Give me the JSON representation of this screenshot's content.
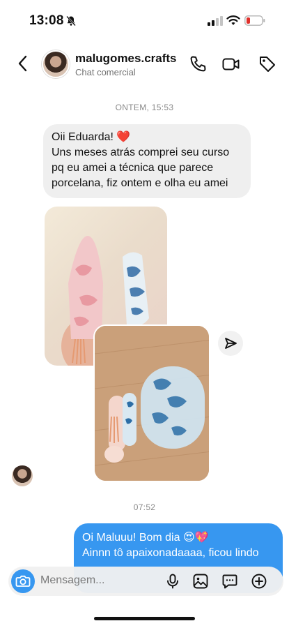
{
  "status_bar": {
    "time": "13:08",
    "icons": [
      "bell-slash-icon",
      "signal-icon",
      "wifi-icon",
      "battery-low-icon"
    ],
    "battery_color": "#e0302b"
  },
  "header": {
    "username": "malugomes.crafts",
    "subtitle": "Chat comercial",
    "icons": [
      "chevron-left-icon",
      "phone-icon",
      "video-camera-icon",
      "tag-icon"
    ]
  },
  "conversation": {
    "date_stamp_1": "ONTEM, 15:53",
    "incoming_message": {
      "line1": "Oii Eduarda! ❤️",
      "line2": "Uns meses atrás comprei seu curso",
      "line3": "pq eu amei a técnica que parece",
      "line4": "porcelana, fiz ontem e olha eu amei"
    },
    "photos": [
      "bookmark-photo-icon",
      "resin-pieces-photo-icon"
    ],
    "date_stamp_2": "07:52",
    "outgoing_message": {
      "line1": "Oi Maluuu! Bom dia 😍💖",
      "line2": "Ainnn tô apaixonadaaaa, ficou lindo"
    }
  },
  "composer": {
    "placeholder": "Mensagem...",
    "icons": [
      "camera-icon",
      "microphone-icon",
      "image-icon",
      "sticker-icon",
      "plus-circle-icon"
    ],
    "accent": "#3797f0"
  },
  "colors": {
    "outgoing_bubble": "#3797f0",
    "incoming_bubble": "#efefef"
  }
}
